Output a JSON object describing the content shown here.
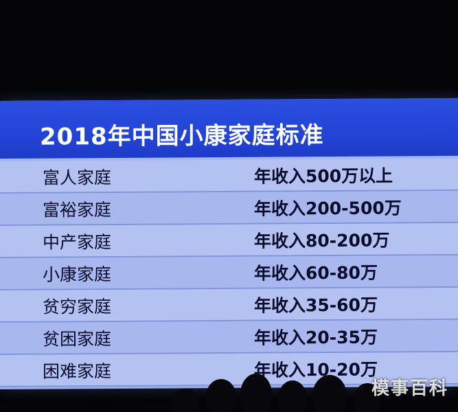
{
  "title": "2018年中国小康家庭标准",
  "rows": [
    {
      "name": "富人家庭",
      "income": "年收入500万以上"
    },
    {
      "name": "富裕家庭",
      "income": "年收入200-500万"
    },
    {
      "name": "中产家庭",
      "income": "年收入80-200万"
    },
    {
      "name": "小康家庭",
      "income": "年收入60-80万"
    },
    {
      "name": "贫穷家庭",
      "income": "年收入35-60万"
    },
    {
      "name": "贫困家庭",
      "income": "年收入20-35万"
    },
    {
      "name": "困难家庭",
      "income": "年收入10-20万"
    }
  ],
  "watermark": "模事百科",
  "colors": {
    "title_bar": "#2344d6",
    "row_light": "#b4c2f2",
    "row_dark": "#a8b8ee",
    "text": "#0b0b2a",
    "background": "#050507"
  }
}
